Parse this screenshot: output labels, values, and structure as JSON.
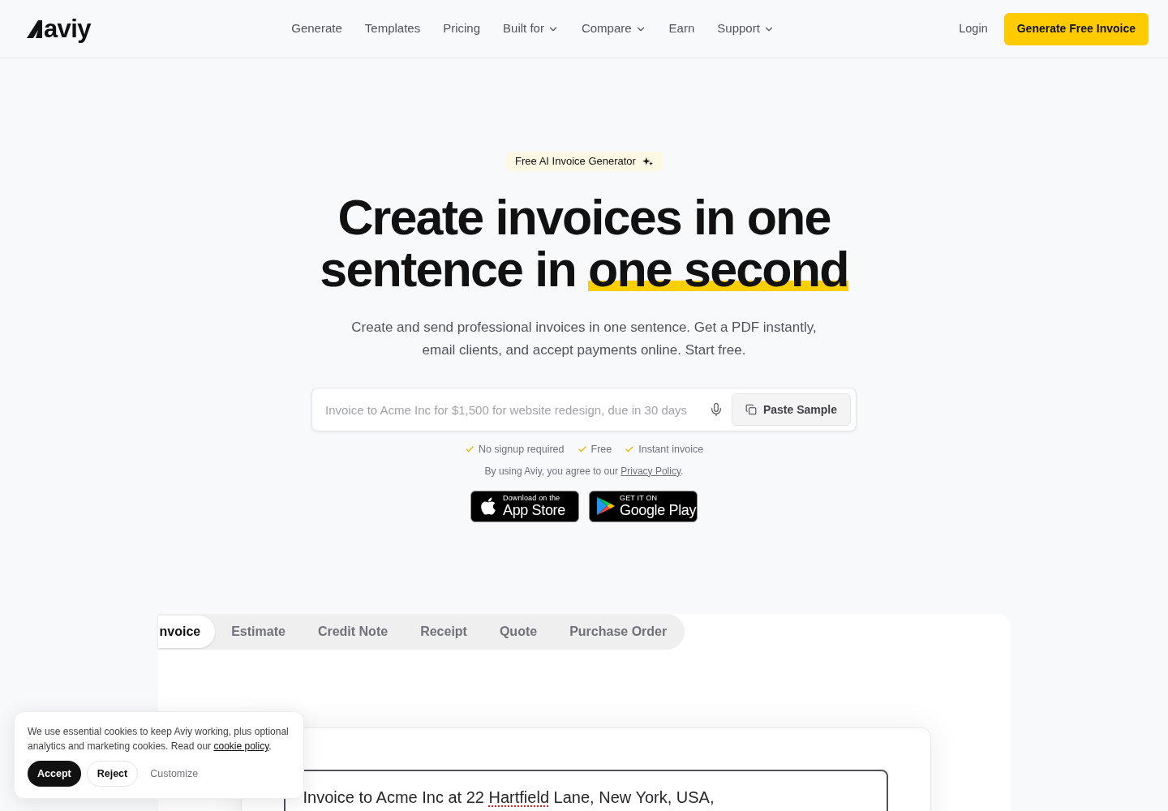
{
  "header": {
    "logo": "aviy",
    "nav": [
      {
        "label": "Generate",
        "dropdown": false
      },
      {
        "label": "Templates",
        "dropdown": false
      },
      {
        "label": "Pricing",
        "dropdown": false
      },
      {
        "label": "Built for",
        "dropdown": true
      },
      {
        "label": "Compare",
        "dropdown": true
      },
      {
        "label": "Earn",
        "dropdown": false
      },
      {
        "label": "Support",
        "dropdown": true
      }
    ],
    "login": "Login",
    "cta": "Generate Free Invoice"
  },
  "hero": {
    "badge": "Free AI Invoice Generator",
    "headline": {
      "line_1": "Create invoices in one",
      "line_2": "sentence in",
      "highlight": "one second"
    },
    "subtitle": "Create and send professional invoices in one sentence. Get a PDF instantly, email clients, and accept payments online. Start free.",
    "prompt": {
      "placeholder": "Invoice to Acme Inc for $1,500 for website redesign, due in 30 days",
      "button": "Paste Sample"
    },
    "benefits": [
      "No signup required",
      "Free",
      "Instant invoice"
    ],
    "consent": {
      "text": "By using Aviy, you agree to our",
      "link": "Privacy Policy",
      "suffix": "."
    },
    "store_badges": [
      {
        "kind": "apple",
        "caption": "Download on the",
        "name": "App Store"
      },
      {
        "kind": "google",
        "caption": "GET IT ON",
        "name": "Google Play"
      }
    ]
  },
  "document_tabs": [
    {
      "label": "nvoice",
      "selected": true
    },
    {
      "label": "Estimate",
      "selected": false
    },
    {
      "label": "Credit Note",
      "selected": false
    },
    {
      "label": "Receipt",
      "selected": false
    },
    {
      "label": "Quote",
      "selected": false
    },
    {
      "label": "Purchase Order",
      "selected": false
    }
  ],
  "editor": {
    "segments": [
      {
        "text": "Invoice to Acme Inc at 22",
        "misspelled": false
      },
      {
        "text": "Hartfield",
        "misspelled": true
      },
      {
        "text": "Lane, New York, USA,",
        "misspelled": false
      }
    ]
  },
  "cookie_banner": {
    "text": "We use essential cookies to keep Aviy working, plus optional analytics and marketing cookies. Read our",
    "link": "cookie policy",
    "suffix": ".",
    "buttons": [
      {
        "label": "Accept",
        "kind": "primary"
      },
      {
        "label": "Reject",
        "kind": "secondary"
      },
      {
        "label": "Customize",
        "kind": "text"
      }
    ]
  }
}
